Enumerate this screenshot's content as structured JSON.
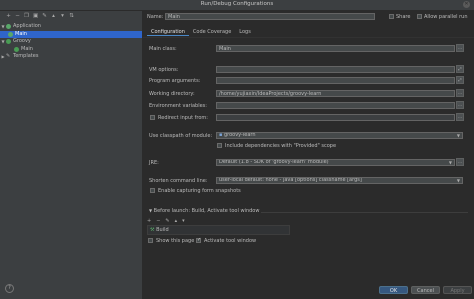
{
  "window": {
    "title": "Run/Debug Configurations"
  },
  "left_toolbar": {
    "icons": [
      "add-icon",
      "remove-icon",
      "copy-icon",
      "save-icon",
      "wrench-icon",
      "move-up-icon",
      "move-down-icon",
      "sort-icon"
    ]
  },
  "tree": {
    "items": [
      {
        "label": "Application",
        "level": 0,
        "expanded": true,
        "icon": "application-icon"
      },
      {
        "label": "Main",
        "level": 1,
        "selected": true,
        "icon": "application-icon"
      },
      {
        "label": "Groovy",
        "level": 0,
        "expanded": true,
        "icon": "groovy-icon"
      },
      {
        "label": "Main",
        "level": 1,
        "icon": "groovy-icon"
      },
      {
        "label": "Templates",
        "level": 0,
        "expanded": false,
        "icon": "wrench-icon"
      }
    ]
  },
  "header": {
    "name_label": "Name:",
    "name_value": "Main",
    "share_label": "Share",
    "allow_parallel_label": "Allow parallel run"
  },
  "tabs": [
    "Configuration",
    "Code Coverage",
    "Logs"
  ],
  "config": {
    "main_class_label": "Main class:",
    "main_class_value": "Main",
    "vm_options_label": "VM options:",
    "program_args_label": "Program arguments:",
    "working_dir_label": "Working directory:",
    "working_dir_value": "/home/yujiaxin/IdeaProjects/groovy-learn",
    "env_vars_label": "Environment variables:",
    "redirect_input_label": "Redirect input from:",
    "classpath_label": "Use classpath of module:",
    "classpath_value": "groovy-learn",
    "include_provided_label": "Include dependencies with \"Provided\" scope",
    "jre_label": "JRE:",
    "jre_value": "Default (1.8 - SDK of 'groovy-learn' module)",
    "shorten_label": "Shorten command line:",
    "shorten_value": "user-local default: none - java [options] classname [args]",
    "capturing_label": "Enable capturing form snapshots"
  },
  "before_launch": {
    "title": "Before launch: Build, Activate tool window",
    "task": "Build",
    "show_page_label": "Show this page",
    "activate_tool_label": "Activate tool window"
  },
  "buttons": {
    "ok": "OK",
    "cancel": "Cancel",
    "apply": "Apply"
  },
  "help": "?"
}
